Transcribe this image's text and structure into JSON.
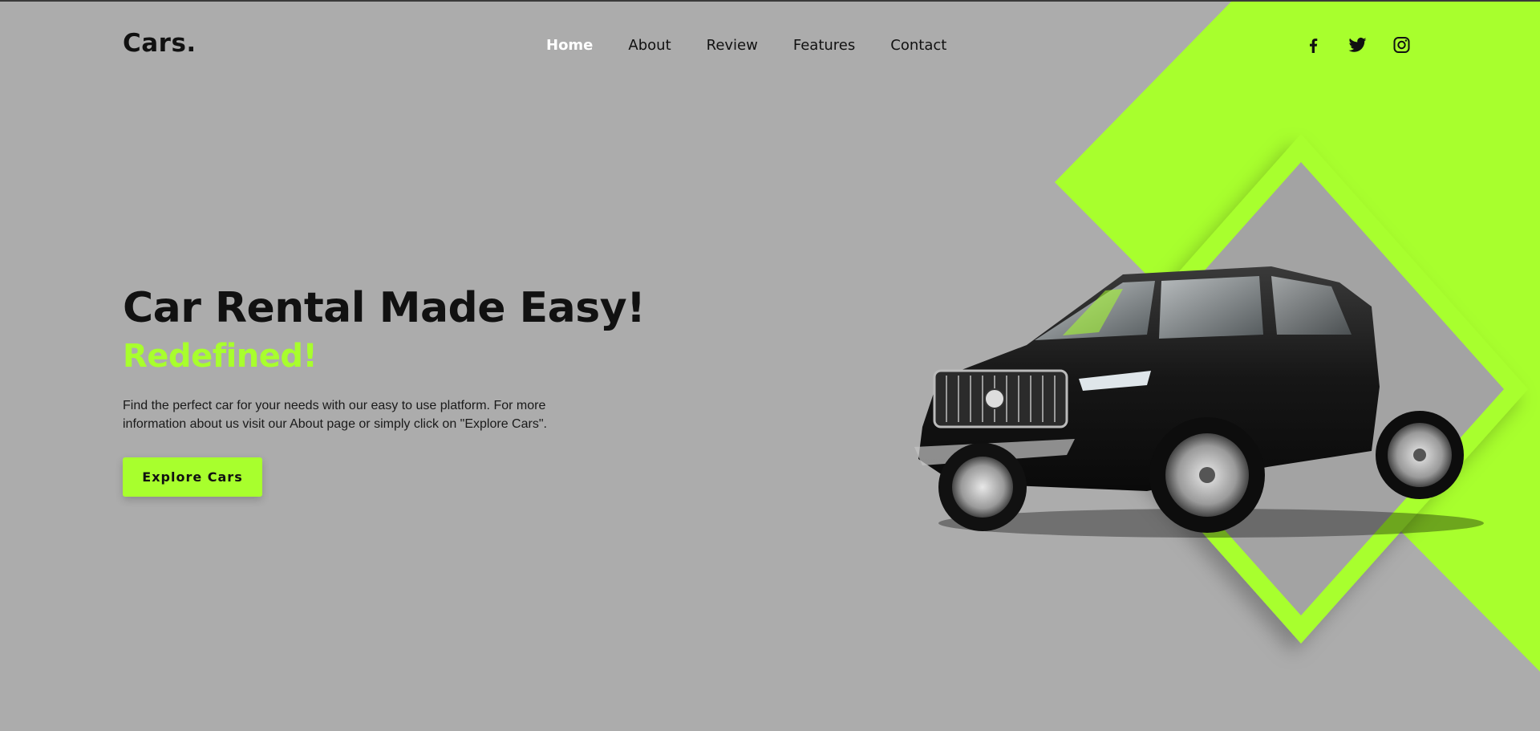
{
  "header": {
    "logo": "Cars.",
    "nav": [
      {
        "label": "Home",
        "active": true
      },
      {
        "label": "About",
        "active": false
      },
      {
        "label": "Review",
        "active": false
      },
      {
        "label": "Features",
        "active": false
      },
      {
        "label": "Contact",
        "active": false
      }
    ],
    "social": [
      {
        "icon": "facebook-icon"
      },
      {
        "icon": "twitter-icon"
      },
      {
        "icon": "instagram-icon"
      }
    ]
  },
  "hero": {
    "title": "Car Rental Made Easy!",
    "subtitle": "Redefined!",
    "description": "Find the perfect car for your needs with our easy to use platform. For more information about us visit our About page or simply click on \"Explore Cars\".",
    "cta_label": "Explore Cars"
  },
  "colors": {
    "background": "#acacac",
    "accent": "#a8ff2d",
    "text": "#111111",
    "nav_active": "#ffffff"
  }
}
